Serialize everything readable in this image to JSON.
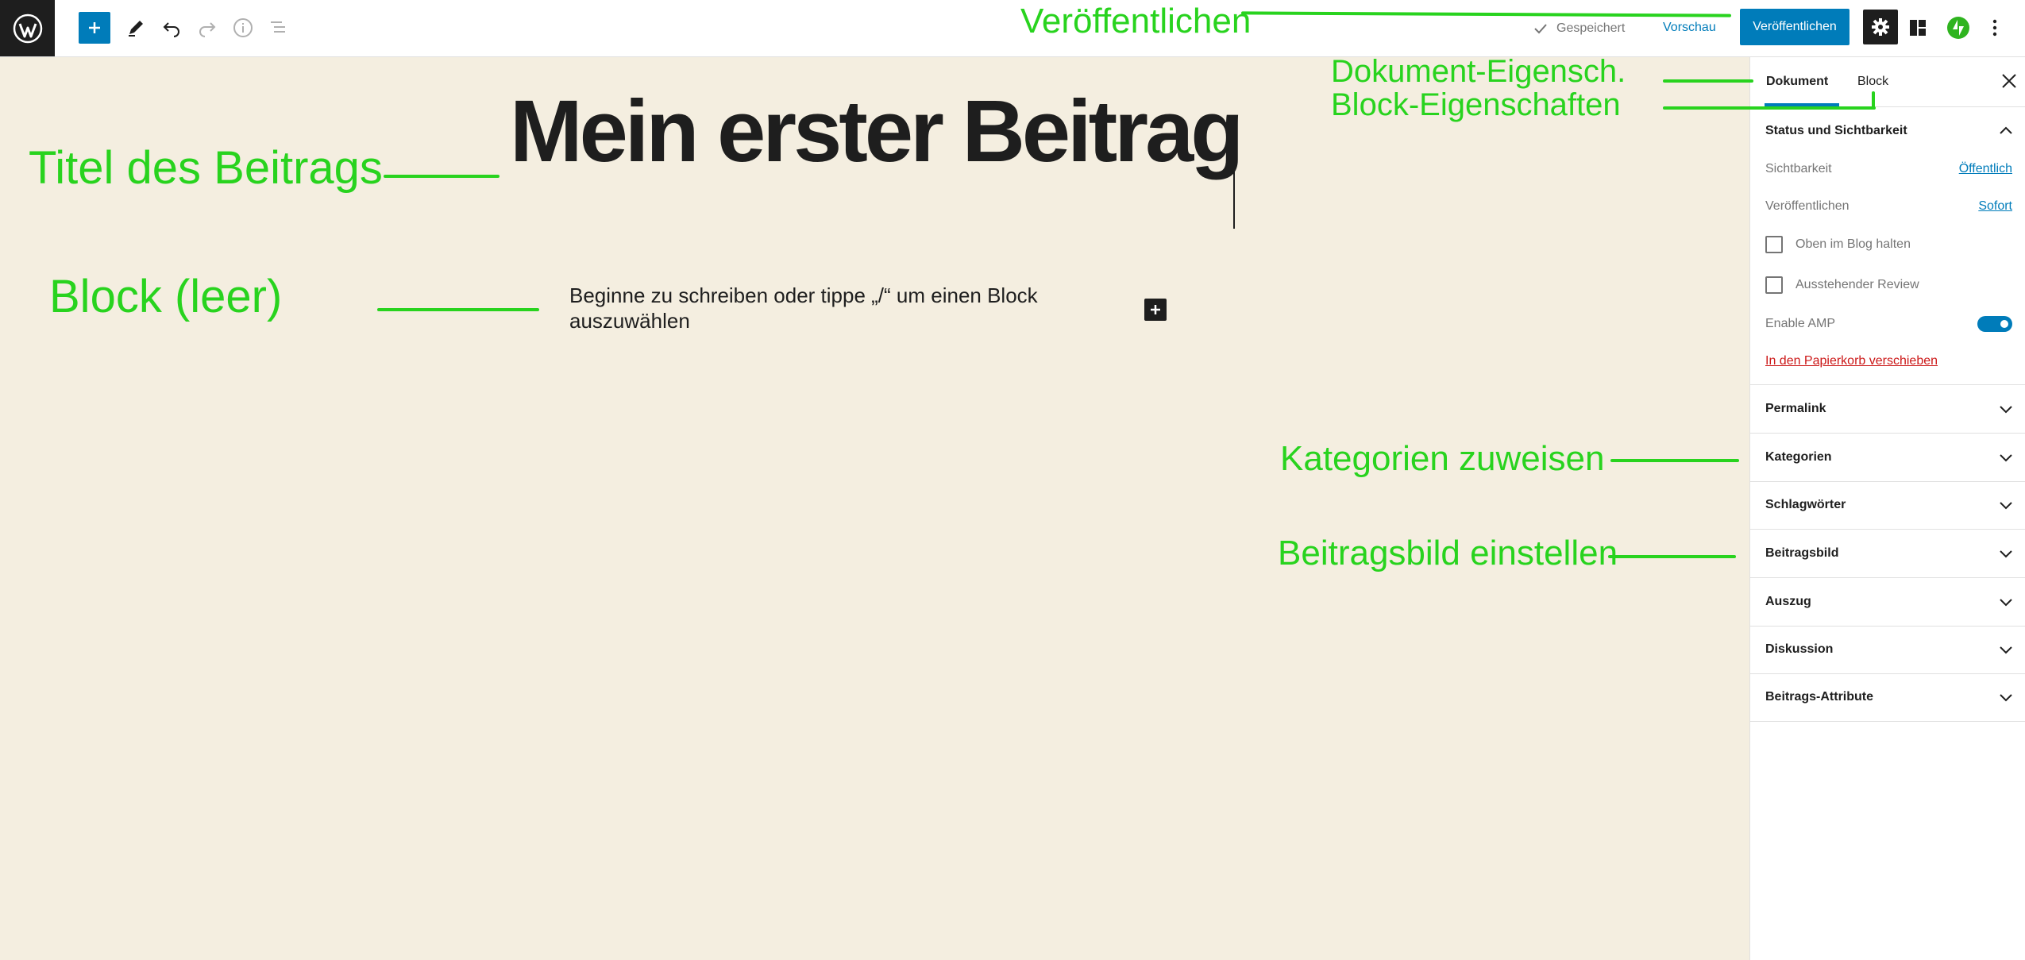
{
  "toolbar": {
    "logo_icon": "wordpress-logo",
    "inserter_icon": "plus-icon",
    "tools_icon": "pencil-icon",
    "undo_icon": "undo-icon",
    "redo_icon": "redo-icon",
    "info_icon": "info-icon",
    "outline_icon": "list-view-icon",
    "saved_label": "Gespeichert",
    "preview_label": "Vorschau",
    "publish_label": "Veröffentlichen",
    "settings_icon": "gear-icon",
    "layout_icon": "layout-icon",
    "jetpack_icon": "jetpack-icon",
    "more_icon": "more-vertical-icon"
  },
  "editor": {
    "title": "Mein erster Beitrag",
    "placeholder": "Beginne zu schreiben oder tippe  „/“  um einen Block auszuwählen"
  },
  "sidebar": {
    "tabs": [
      "Dokument",
      "Block"
    ],
    "status": {
      "title": "Status und Sichtbarkeit",
      "visibility_label": "Sichtbarkeit",
      "visibility_value": "Öffentlich",
      "publish_label": "Veröffentlichen",
      "publish_value": "Sofort",
      "sticky_label": "Oben im Blog halten",
      "pending_label": "Ausstehender Review",
      "amp_label": "Enable AMP",
      "trash_label": "In den Papierkorb verschieben"
    },
    "panels": [
      "Permalink",
      "Kategorien",
      "Schlagwörter",
      "Beitragsbild",
      "Auszug",
      "Diskussion",
      "Beitrags-Attribute"
    ]
  },
  "annotations": {
    "publish": "Veröffentlichen",
    "document_props": "Dokument-Eigensch.",
    "block_props": "Block-Eigenschaften",
    "post_title": "Titel des Beitrags",
    "block_empty": "Block (leer)",
    "categories": "Kategorien zuweisen",
    "featured_image": "Beitragsbild einstellen"
  },
  "colors": {
    "accent": "#007cba",
    "canvas_bg": "#f4eee0",
    "annotation": "#28d31e",
    "danger": "#cc1818"
  }
}
